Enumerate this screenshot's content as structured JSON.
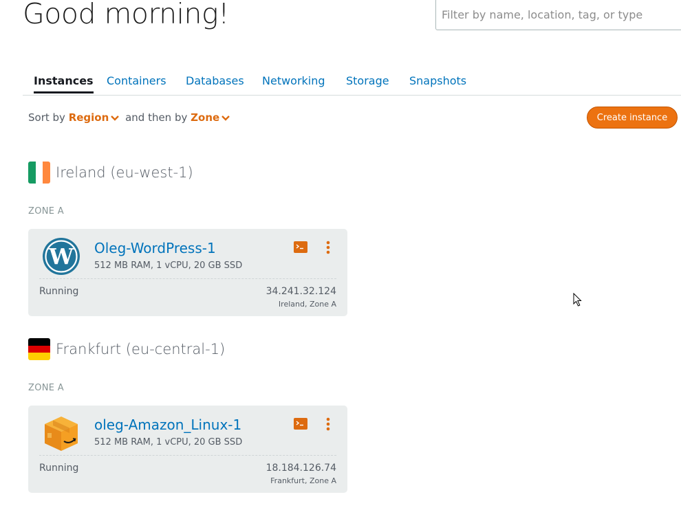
{
  "header": {
    "greeting": "Good morning!",
    "search_placeholder": "Filter by name, location, tag, or type"
  },
  "tabs": [
    {
      "label": "Instances",
      "active": true
    },
    {
      "label": "Containers",
      "active": false
    },
    {
      "label": "Databases",
      "active": false
    },
    {
      "label": "Networking",
      "active": false
    },
    {
      "label": "Storage",
      "active": false
    },
    {
      "label": "Snapshots",
      "active": false
    }
  ],
  "sort": {
    "prefix": "Sort by",
    "primary": "Region",
    "middle": "and then by",
    "secondary": "Zone"
  },
  "create_button": "Create instance",
  "regions": [
    {
      "name": "Ireland (eu-west-1)",
      "flag": "ireland-flag",
      "zone": "ZONE A",
      "instance": {
        "name": "Oleg-WordPress-1",
        "spec": "512 MB RAM, 1 vCPU, 20 GB SSD",
        "status": "Running",
        "ip": "34.241.32.124",
        "location": "Ireland, Zone A",
        "icon": "wordpress-icon"
      }
    },
    {
      "name": "Frankfurt (eu-central-1)",
      "flag": "germany-flag",
      "zone": "ZONE A",
      "instance": {
        "name": "oleg-Amazon_Linux-1",
        "spec": "512 MB RAM, 1 vCPU, 20 GB SSD",
        "status": "Running",
        "ip": "18.184.126.74",
        "location": "Frankfurt, Zone A",
        "icon": "amazon-linux-box-icon"
      }
    }
  ],
  "colors": {
    "accent": "#ec7211",
    "link": "#0073bb",
    "card_bg": "#eaeded",
    "sort_highlight": "#dd6b10"
  }
}
